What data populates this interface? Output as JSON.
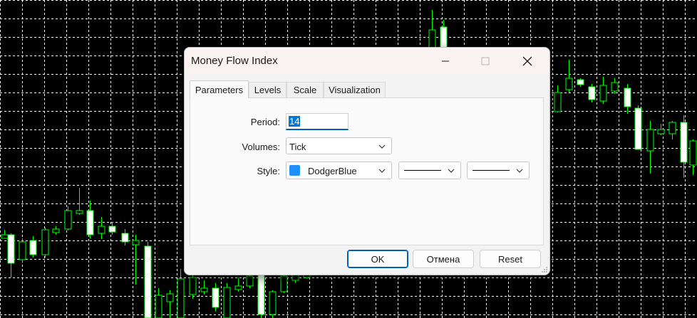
{
  "dialog": {
    "title": "Money Flow Index",
    "tabs": [
      "Parameters",
      "Levels",
      "Scale",
      "Visualization"
    ],
    "active_tab": "Parameters"
  },
  "parameters": {
    "period_label": "Period:",
    "period_value": "14",
    "volumes_label": "Volumes:",
    "volumes_value": "Tick",
    "style_label": "Style:",
    "style_color_name": "DodgerBlue",
    "style_color_hex": "#1e90ff"
  },
  "buttons": {
    "ok": "OK",
    "cancel": "Отмена",
    "reset": "Reset"
  },
  "icons": {
    "minimize": "minimize-icon",
    "maximize": "maximize-icon",
    "close": "close-icon",
    "dropdown": "chevron-down-icon"
  },
  "chart_colors": {
    "background": "#000000",
    "grid": "#ffffff",
    "candle": "#00ff00",
    "bull_body": "#000000",
    "bear_body": "#ffffff"
  }
}
